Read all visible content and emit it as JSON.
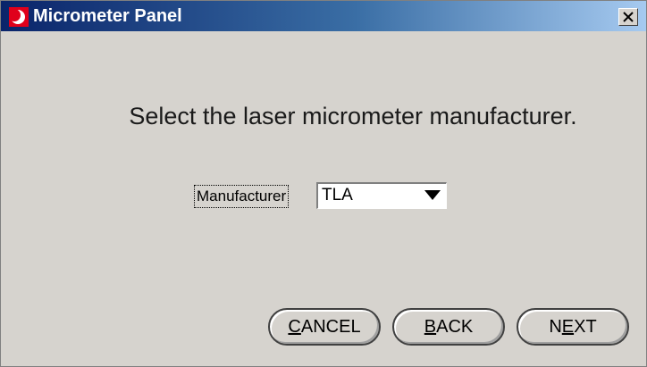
{
  "window": {
    "title": "Micrometer Panel",
    "app_icon": "moon-logo-icon",
    "close_icon": "close-icon"
  },
  "main": {
    "prompt": "Select the laser micrometer manufacturer.",
    "manufacturer_label": "Manufacturer",
    "manufacturer_value": "TLA"
  },
  "buttons": {
    "cancel": {
      "mnemonic": "C",
      "rest": "ANCEL"
    },
    "back": {
      "mnemonic": "B",
      "rest": "ACK"
    },
    "next": {
      "prefix": "N",
      "mnemonic": "E",
      "rest": "XT"
    }
  },
  "colors": {
    "titlebar_start": "#0a246a",
    "titlebar_end": "#a6caf0",
    "window_bg": "#d6d3ce",
    "icon_red": "#e0001b"
  }
}
